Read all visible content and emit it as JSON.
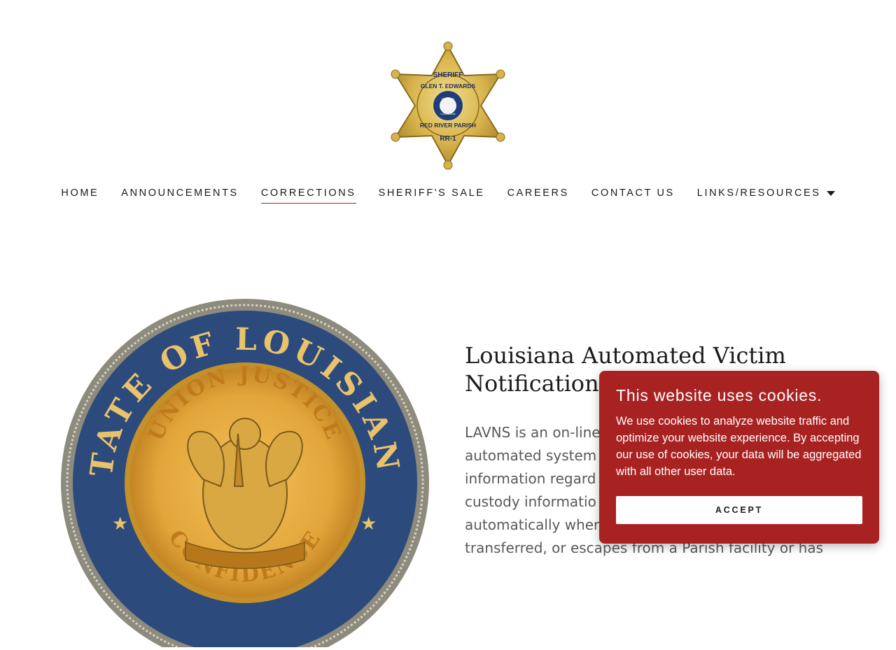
{
  "logo": {
    "line1": "SHERIFF",
    "line2": "GLEN T. EDWARDS",
    "line3": "RED RIVER PARISH",
    "line4": "RR-1",
    "center_top": "STATE OF",
    "center_bottom": "LOUISIANA"
  },
  "nav": {
    "items": [
      {
        "label": "HOME"
      },
      {
        "label": "ANNOUNCEMENTS"
      },
      {
        "label": "CORRECTIONS"
      },
      {
        "label": "SHERIFF'S SALE"
      },
      {
        "label": "CAREERS"
      },
      {
        "label": "CONTACT US"
      },
      {
        "label": "LINKS/RESOURCES"
      }
    ],
    "active": "CORRECTIONS"
  },
  "seal": {
    "outer_text": "STATE OF LOUISIANA",
    "inner_text": "UNION JUSTICE",
    "bottom_text": "CONFIDENCE"
  },
  "content": {
    "heading_line1": "Louisiana Automated Victim",
    "heading_line2": "Notification",
    "paragraph_lines": [
      "LAVNS is an on-line",
      "automated system",
      "information regard",
      "custody informatio",
      "automatically wher",
      "transferred, or escapes from a Parish facility or has"
    ]
  },
  "cookie_banner": {
    "title": "This website uses cookies.",
    "text": "We use cookies to analyze website traffic and optimize your website experience. By accepting our use of cookies, your data will be aggregated with all other user data.",
    "accept_label": "ACCEPT"
  },
  "colors": {
    "accent": "#a52a24",
    "cookie_bg": "#a92222",
    "badge_gold": "#d9b44a",
    "seal_blue": "#2c4a7c",
    "seal_gold": "#e2a53a"
  }
}
